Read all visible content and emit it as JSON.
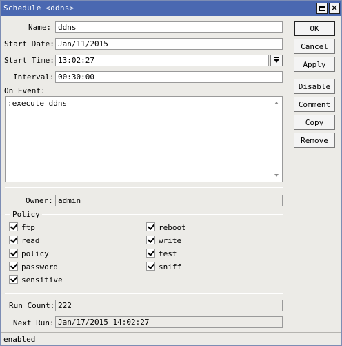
{
  "window": {
    "title": "Schedule <ddns>"
  },
  "form": {
    "name_label": "Name:",
    "name_value": "ddns",
    "start_date_label": "Start Date:",
    "start_date_value": "Jan/11/2015",
    "start_time_label": "Start Time:",
    "start_time_value": "13:02:27",
    "interval_label": "Interval:",
    "interval_value": "00:30:00",
    "on_event_label": "On Event:",
    "on_event_value": ":execute ddns",
    "owner_label": "Owner:",
    "owner_value": "admin",
    "policy_label": "Policy",
    "run_count_label": "Run Count:",
    "run_count_value": "222",
    "next_run_label": "Next Run:",
    "next_run_value": "Jan/17/2015 14:02:27"
  },
  "policy": {
    "items": [
      {
        "label": "ftp",
        "checked": true
      },
      {
        "label": "reboot",
        "checked": true
      },
      {
        "label": "read",
        "checked": true
      },
      {
        "label": "write",
        "checked": true
      },
      {
        "label": "policy",
        "checked": true
      },
      {
        "label": "test",
        "checked": true
      },
      {
        "label": "password",
        "checked": true
      },
      {
        "label": "sniff",
        "checked": true
      },
      {
        "label": "sensitive",
        "checked": true
      }
    ]
  },
  "buttons": {
    "ok": "OK",
    "cancel": "Cancel",
    "apply": "Apply",
    "disable": "Disable",
    "comment": "Comment",
    "copy": "Copy",
    "remove": "Remove"
  },
  "status": {
    "text": "enabled"
  },
  "icons": {
    "maximize": "maximize-icon",
    "close": "close-icon",
    "dropdown": "dropdown-arrow-icon"
  },
  "colors": {
    "titlebar": "#4a68b1",
    "window_bg": "#ecebe7"
  }
}
